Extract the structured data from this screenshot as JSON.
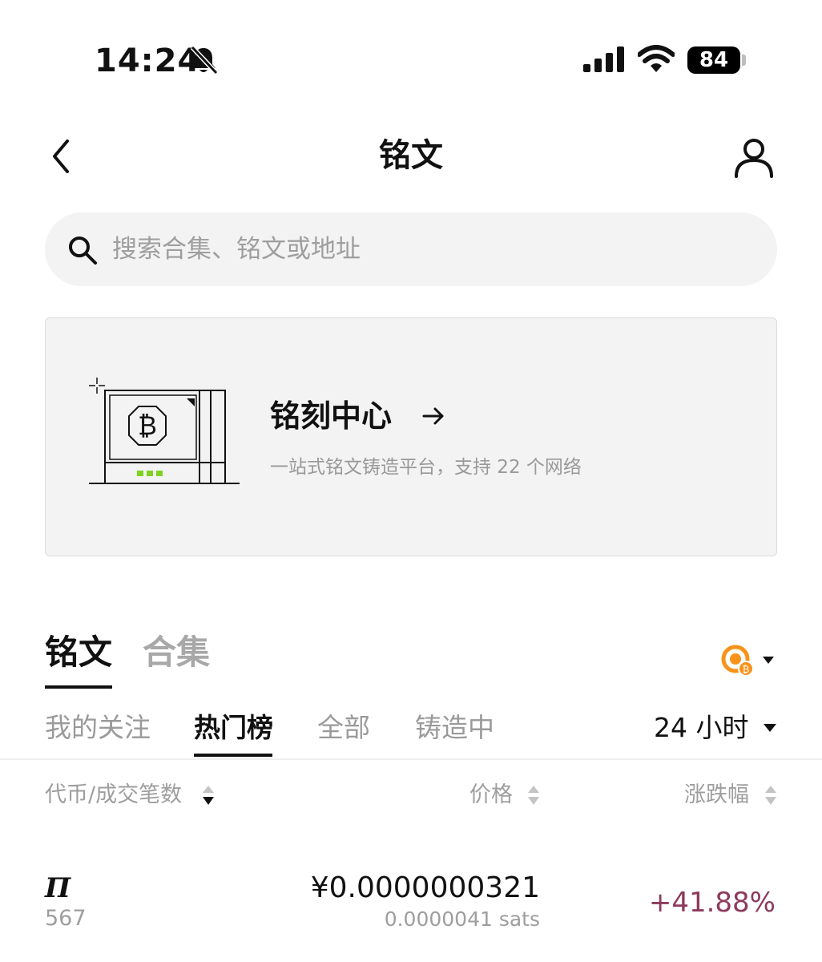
{
  "status_bar": {
    "time": "14:24",
    "battery": "84"
  },
  "header": {
    "title": "铭文"
  },
  "search": {
    "placeholder": "搜索合集、铭文或地址"
  },
  "banner": {
    "title": "铭刻中心",
    "subtitle": "一站式铭文铸造平台，支持 22 个网络"
  },
  "main_tabs": [
    {
      "label": "铭文",
      "active": true
    },
    {
      "label": "合集",
      "active": false
    }
  ],
  "sub_tabs": [
    {
      "label": "我的关注",
      "active": false
    },
    {
      "label": "热门榜",
      "active": true
    },
    {
      "label": "全部",
      "active": false
    },
    {
      "label": "铸造中",
      "active": false
    }
  ],
  "time_range": "24 小时",
  "table": {
    "columns": [
      "代币/成交笔数",
      "价格",
      "涨跌幅"
    ],
    "rows": [
      {
        "name": "Π",
        "count": "567",
        "price": "¥0.0000000321",
        "sats": "0.0000041 sats",
        "change": "+41.88%"
      }
    ]
  },
  "colors": {
    "positive_change": "#8c3a5c",
    "bitcoin_orange": "#f7931a",
    "miner_led": "#7ed321"
  },
  "icons": [
    "bell-slash-icon",
    "signal-icon",
    "wifi-icon",
    "back-icon",
    "profile-icon",
    "search-icon",
    "arrow-right-icon",
    "bitcoin-chain-icon",
    "caret-down-icon",
    "sort-icon"
  ]
}
